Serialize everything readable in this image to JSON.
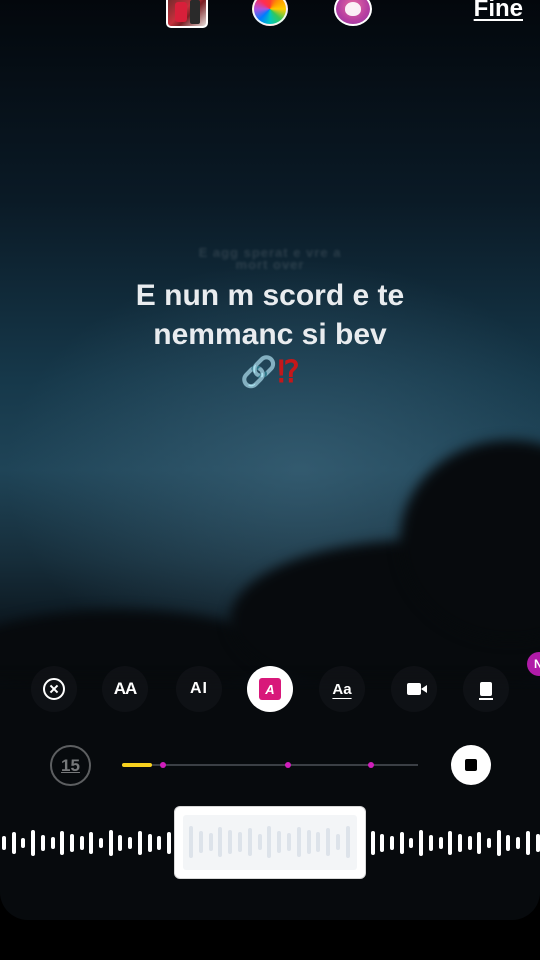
{
  "top_bar": {
    "done_label": "Fine",
    "icons": [
      "media-thumbnail",
      "color-wheel-icon",
      "sticker-icon"
    ]
  },
  "lyrics": {
    "previous_line_1": "E agg sperat e vre a",
    "previous_line_2": "mort over",
    "current_line_1": "E nun m scord e te",
    "current_line_2": "nemmanc si bev",
    "current_emoji": "🔗⁉️",
    "emoji_chain": "🔗",
    "emoji_mark": "⁉"
  },
  "toolbar": {
    "close": "close-circle-icon",
    "text_size_label": "AA",
    "align_label": "AI",
    "style_label": "A",
    "font_label": "Aa",
    "video_icon": "video-camera-icon",
    "more_icon": "more-icon",
    "badge_label": "N",
    "active_color": "#d8187a"
  },
  "timeline": {
    "duration_label": "15",
    "progress_fraction": 0.1,
    "marker_fractions": [
      0.14,
      0.56,
      0.84
    ],
    "progress_color": "#f7d11e",
    "marker_color": "#d01ebb"
  }
}
